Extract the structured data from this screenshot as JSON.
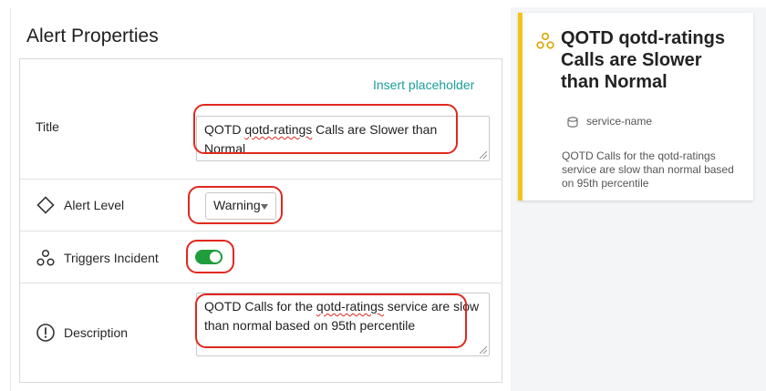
{
  "panel": {
    "title": "Alert Properties"
  },
  "form": {
    "insert_placeholder": "Insert placeholder",
    "title": {
      "label": "Title",
      "value_prefix": "QOTD ",
      "value_misspelled": "qotd-ratings",
      "value_suffix": " Calls are Slower than Normal"
    },
    "alert_level": {
      "label": "Alert Level",
      "value": "Warning"
    },
    "triggers_incident": {
      "label": "Triggers Incident",
      "on": true
    },
    "description": {
      "label": "Description",
      "value_prefix": "QOTD Calls for the ",
      "value_misspelled": "qotd-ratings",
      "value_suffix": " service are slow than normal based on 95th percentile"
    }
  },
  "preview": {
    "title": "QOTD qotd-ratings Calls are Slower than Normal",
    "service": "service-name",
    "description": "QOTD Calls for the qotd-ratings service are slow than normal based on 95th percentile",
    "accent_color": "#f0c419"
  },
  "icons": {
    "alert_level": "diamond-icon",
    "triggers_incident": "nodes-icon",
    "description": "exclamation-circle-icon",
    "service": "database-icon",
    "preview": "nodes-icon"
  },
  "colors": {
    "link": "#1a9e9a",
    "toggle_on": "#1e9e3c",
    "annotation": "#e0281e"
  }
}
